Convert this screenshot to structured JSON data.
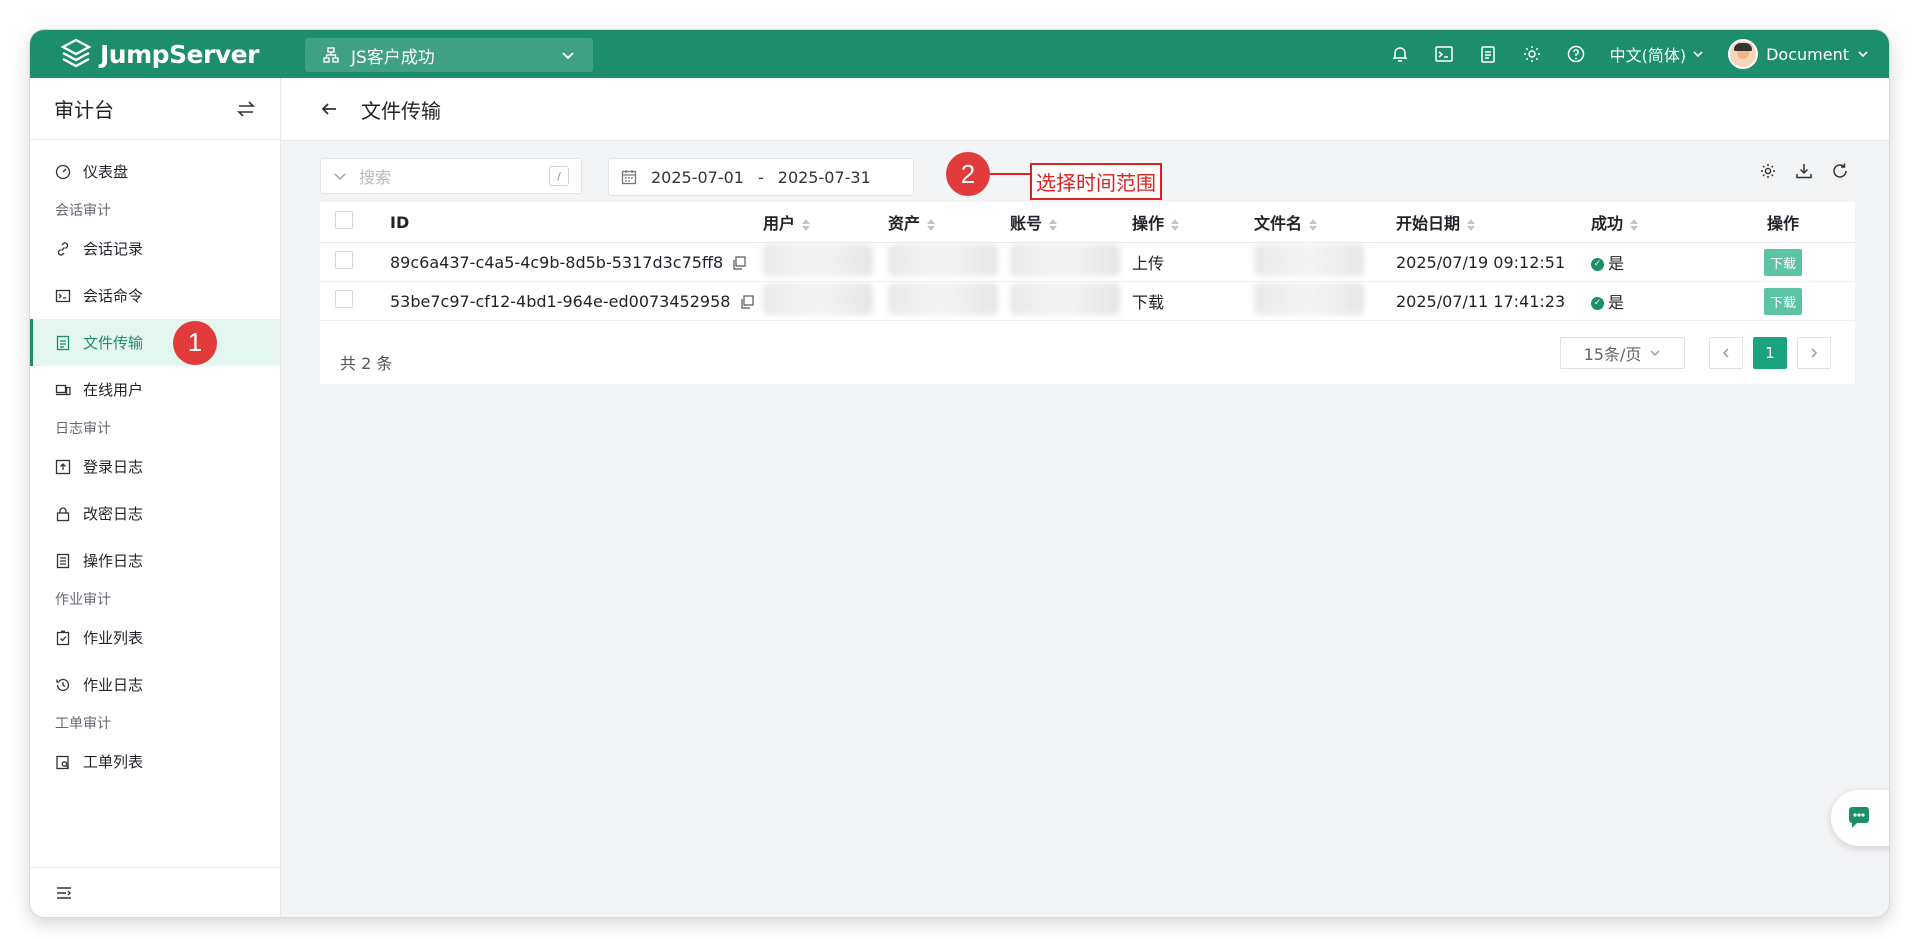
{
  "app": {
    "brand": "JumpServer",
    "org": "JS客户成功"
  },
  "header": {
    "language": "中文(简体)",
    "user": "Document"
  },
  "sidebar": {
    "title": "审计台",
    "items": [
      {
        "label": "仪表盘"
      },
      {
        "group": "会话审计"
      },
      {
        "label": "会话记录"
      },
      {
        "label": "会话命令"
      },
      {
        "label": "文件传输",
        "active": true
      },
      {
        "label": "在线用户"
      },
      {
        "group": "日志审计"
      },
      {
        "label": "登录日志"
      },
      {
        "label": "改密日志"
      },
      {
        "label": "操作日志"
      },
      {
        "group": "作业审计"
      },
      {
        "label": "作业列表"
      },
      {
        "label": "作业日志"
      },
      {
        "group": "工单审计"
      },
      {
        "label": "工单列表"
      }
    ]
  },
  "page": {
    "title": "文件传输"
  },
  "toolbar": {
    "search_placeholder": "搜索",
    "search_hotkey": "/",
    "date_start": "2025-07-01",
    "date_sep": "-",
    "date_end": "2025-07-31"
  },
  "annotations": {
    "step1": "1",
    "step2": "2",
    "callout": "选择时间范围"
  },
  "table": {
    "columns": [
      "ID",
      "用户",
      "资产",
      "账号",
      "操作",
      "文件名",
      "开始日期",
      "成功",
      "操作"
    ],
    "rows": [
      {
        "id": "89c6a437-c4a5-4c9b-8d5b-5317d3c75ff8",
        "operate": "上传",
        "date": "2025/07/19 09:12:51",
        "success": "是",
        "action": "下载"
      },
      {
        "id": "53be7c97-cf12-4bd1-964e-ed0073452958",
        "operate": "下载",
        "date": "2025/07/11 17:41:23",
        "success": "是",
        "action": "下载"
      }
    ]
  },
  "footer": {
    "total": "共 2 条",
    "page_size": "15条/页",
    "current_page": "1"
  },
  "colors": {
    "brand": "#1c8e6c",
    "annotation": "#e23b3b"
  }
}
